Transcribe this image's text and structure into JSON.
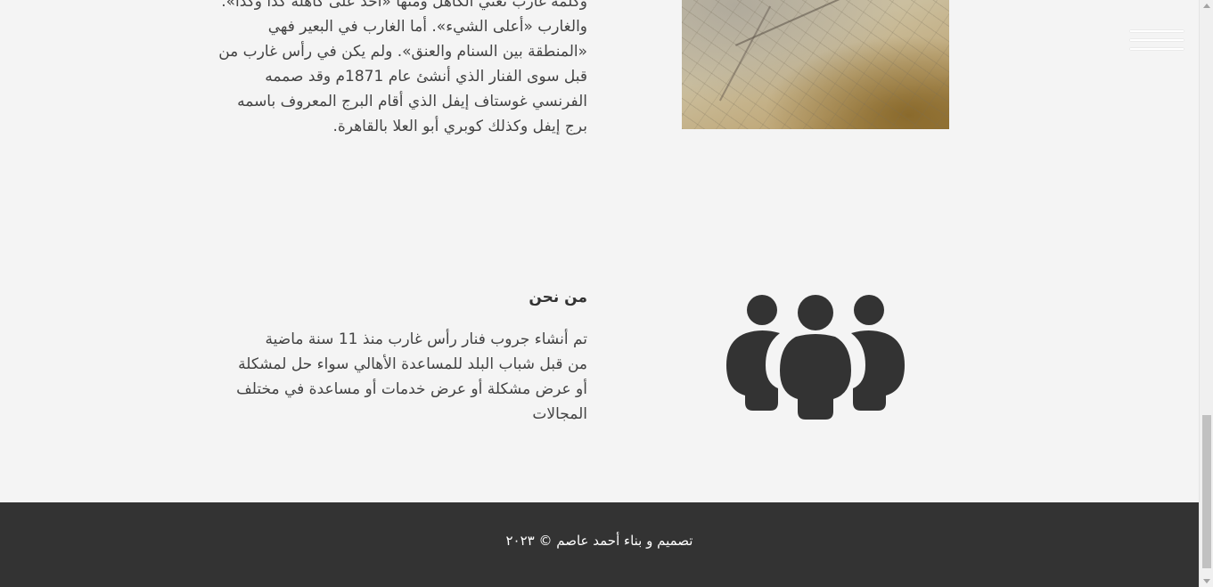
{
  "about": {
    "paragraph_lines": [
      "وكلمة غارب تعني الكاهل ومنها «أحد على كاهله كذا وكذا».",
      "والغارب «أعلى الشيء». أما الغارب في البعير فهي",
      "«المنطقة بين السنام والعنق». ولم يكن في رأس غارب من",
      "قبل سوى الفنار الذي أنشئ عام 1871م وقد صممه",
      "الفرنسي غوستاف إيفل الذي أقام البرج المعروف باسمه",
      "برج إيفل وكذلك كوبري أبو العلا بالقاهرة."
    ]
  },
  "who": {
    "title": "من نحن",
    "paragraph_lines": [
      "تم أنشاء جروب فنار رأس غارب منذ 11 سنة ماضية",
      "من قبل شباب البلد للمساعدة الأهالي سواء حل لمشكلة",
      "أو عرض مشكلة أو عرض خدمات أو مساعدة في مختلف",
      "المجالات"
    ]
  },
  "footer": {
    "credit": "تصميم و بناء أحمد عاصم © ٢٠٢٣"
  },
  "icons": {
    "menu": "hamburger-menu-icon",
    "people": "group-people-icon"
  },
  "colors": {
    "background": "#f4f4f4",
    "footer": "#333333",
    "icon": "#333333",
    "text": "#444444"
  }
}
